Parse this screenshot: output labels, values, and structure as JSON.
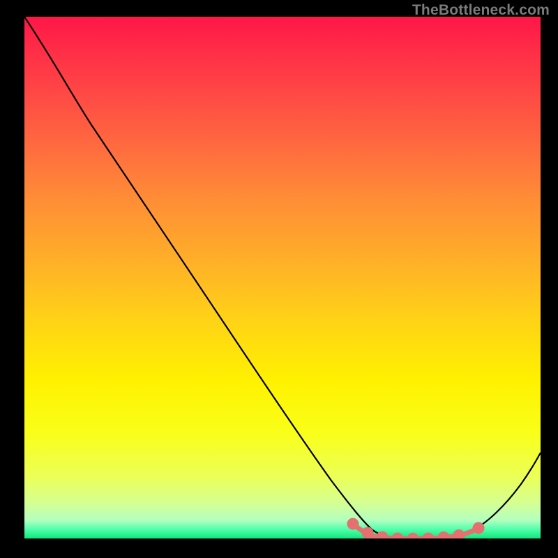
{
  "watermark": "TheBottleneck.com",
  "chart_data": {
    "type": "line",
    "title": "",
    "xlabel": "",
    "ylabel": "",
    "xlim": [
      0,
      100
    ],
    "ylim": [
      0,
      100
    ],
    "series": [
      {
        "name": "curve",
        "x": [
          0,
          5,
          10,
          15,
          20,
          25,
          30,
          35,
          40,
          45,
          50,
          55,
          60,
          62,
          65,
          68,
          70,
          73,
          76,
          79,
          82,
          85,
          88,
          92,
          96,
          100
        ],
        "y": [
          100,
          93.5,
          86,
          78,
          70,
          62,
          53.5,
          45,
          36.5,
          28,
          19.5,
          11.5,
          5,
          3.3,
          1.5,
          0.5,
          0.1,
          0.0,
          0.0,
          0.05,
          0.2,
          0.9,
          2.3,
          5.5,
          10.5,
          16.5
        ]
      }
    ],
    "highlight": {
      "name": "optimal-range",
      "x": [
        63,
        66,
        69,
        72,
        75,
        78,
        81,
        84,
        87
      ],
      "y": [
        2.6,
        1.1,
        0.35,
        0.05,
        0.0,
        0.03,
        0.12,
        0.6,
        1.8
      ]
    },
    "background_gradient": {
      "top": "#ff1648",
      "mid_orange": "#ff8d36",
      "mid_yellow": "#ffd217",
      "light_yellow": "#fff200",
      "pale": "#d6ff90",
      "bottom": "#11e67b"
    }
  }
}
